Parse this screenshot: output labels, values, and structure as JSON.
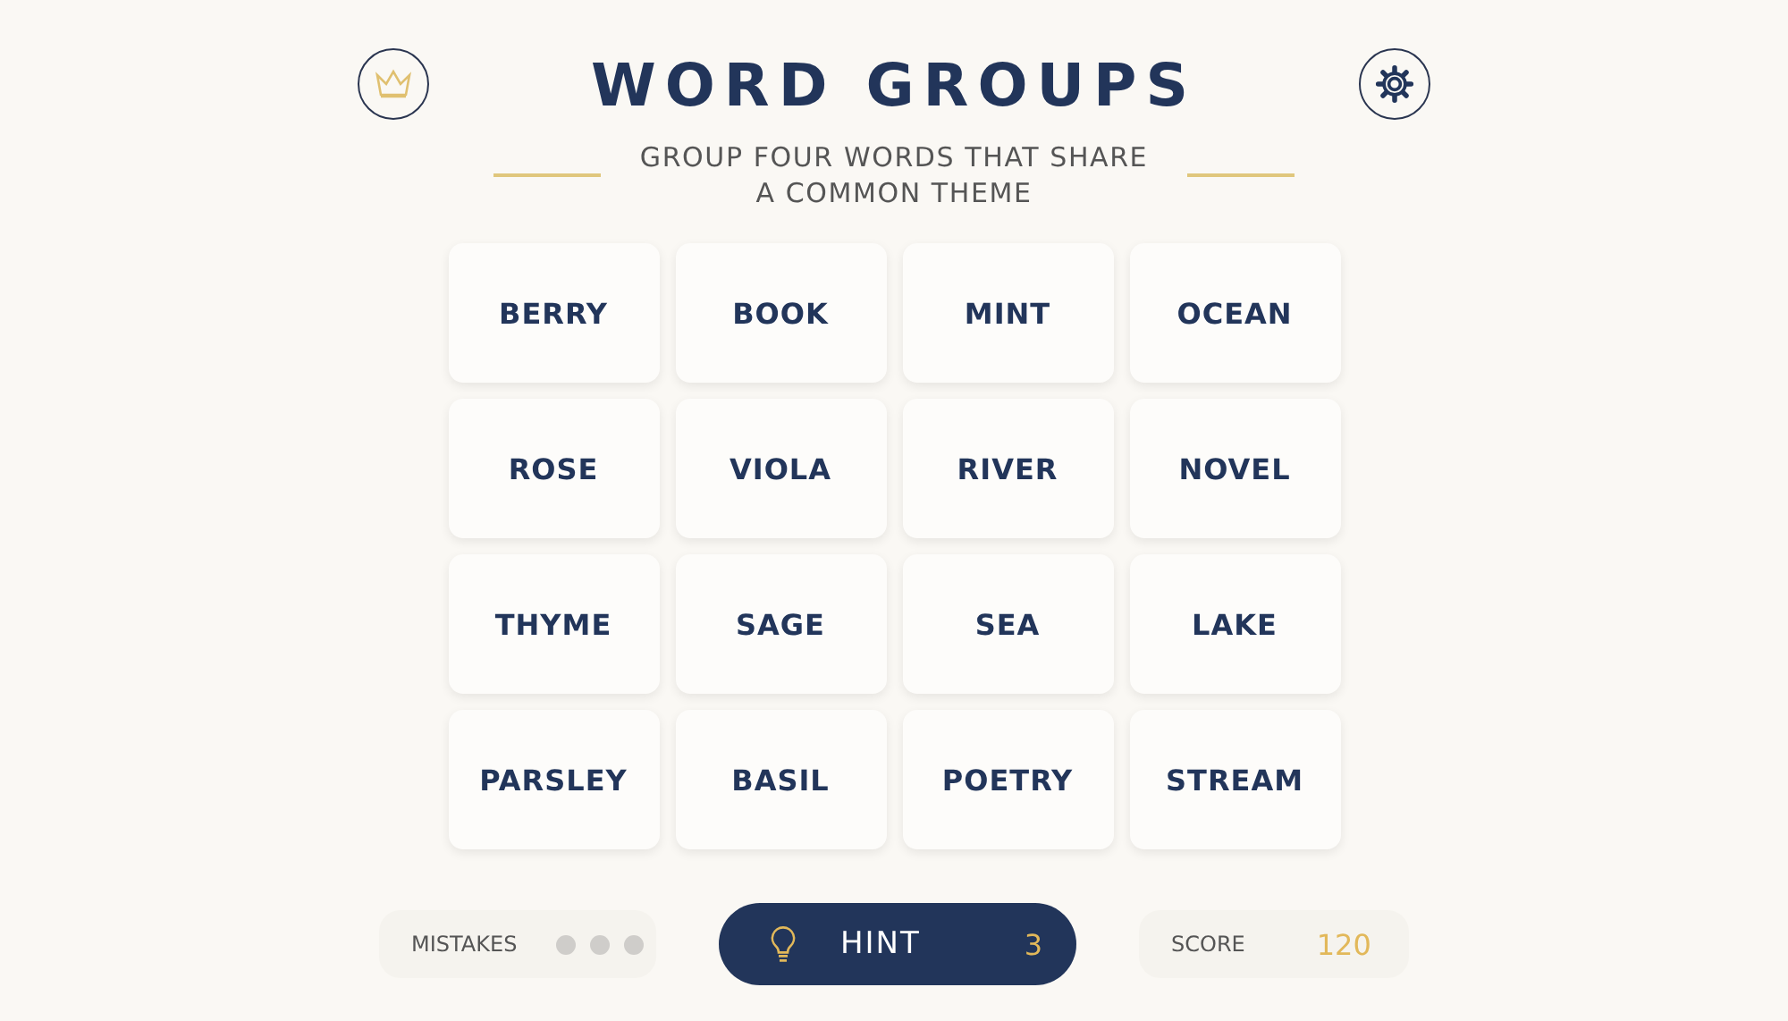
{
  "title": "WORD GROUPS",
  "subtitle": "GROUP FOUR WORDS THAT SHARE A COMMON THEME",
  "tiles": [
    {
      "word": "BERRY",
      "selected": false
    },
    {
      "word": "BOOK",
      "selected": false
    },
    {
      "word": "MINT",
      "selected": false
    },
    {
      "word": "OCEAN",
      "selected": false
    },
    {
      "word": "ROSE",
      "selected": false
    },
    {
      "word": "VIOLA",
      "selected": false
    },
    {
      "word": "RIVER",
      "selected": false
    },
    {
      "word": "NOVEL",
      "selected": false
    },
    {
      "word": "THYME",
      "selected": false
    },
    {
      "word": "SAGE",
      "selected": false
    },
    {
      "word": "SEA",
      "selected": false
    },
    {
      "word": "LAKE",
      "selected": false
    },
    {
      "word": "PARSLEY",
      "selected": false
    },
    {
      "word": "BASIL",
      "selected": false
    },
    {
      "word": "POETRY",
      "selected": false
    },
    {
      "word": "STREAM",
      "selected": false
    }
  ],
  "mistakes": {
    "label": "MISTAKES",
    "dots": [
      {
        "used": false
      },
      {
        "used": false
      },
      {
        "used": false
      }
    ]
  },
  "hint": {
    "label": "HINT",
    "count": "3"
  },
  "score": {
    "label": "SCORE",
    "value": "120"
  }
}
